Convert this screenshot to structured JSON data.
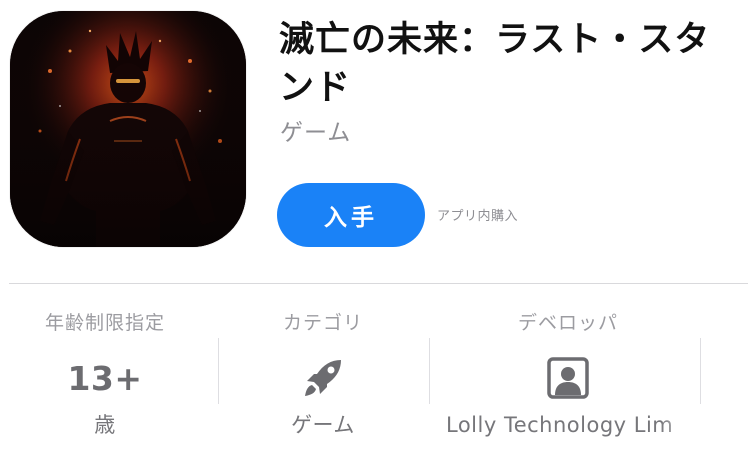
{
  "app": {
    "title": "滅亡の未来：ラスト・スタンド",
    "subtitle": "ゲーム",
    "get_label": "入手",
    "iap_note": "アプリ内購入",
    "icon": "app-icon-warrior-art",
    "accent_color": "#1a82f7"
  },
  "info": {
    "age": {
      "label": "年齢制限指定",
      "value": "13+",
      "sub": "歳"
    },
    "category": {
      "label": "カテゴリ",
      "icon": "rocket-icon",
      "sub": "ゲーム"
    },
    "developer": {
      "label": "デベロッパ",
      "icon": "person-icon",
      "sub": "Lolly Technology Lim"
    }
  }
}
